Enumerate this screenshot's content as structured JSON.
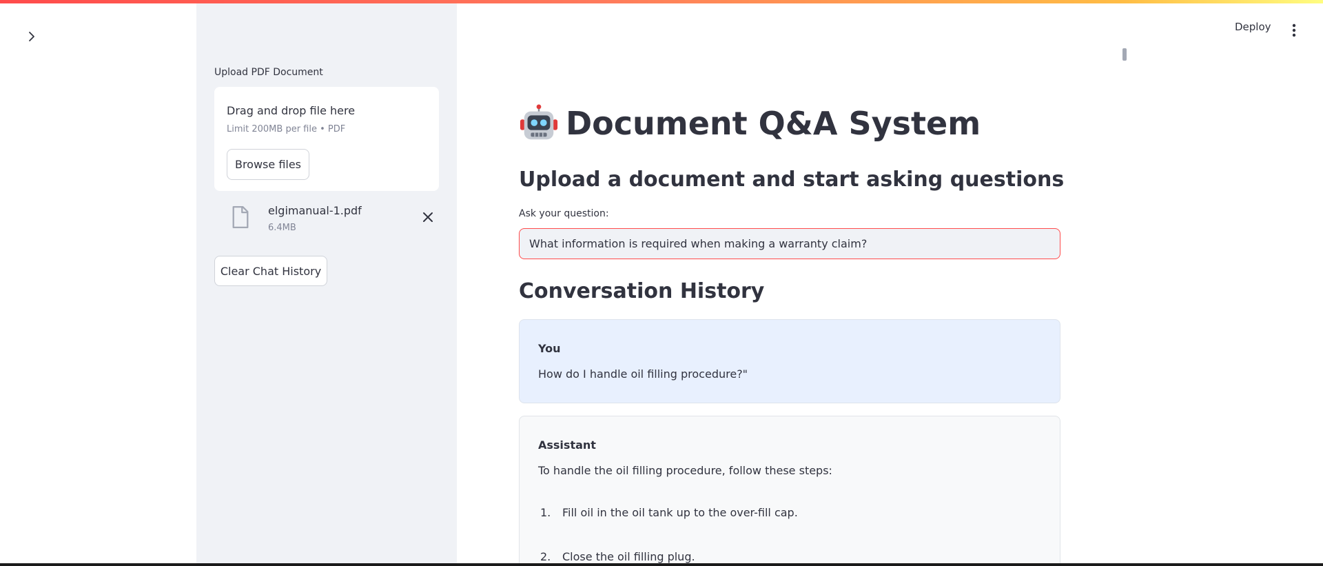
{
  "sidebar": {
    "uploader_label": "Upload PDF Document",
    "dropzone_title": "Drag and drop file here",
    "dropzone_limit": "Limit 200MB per file • PDF",
    "browse_label": "Browse files",
    "file": {
      "name": "elgimanual-1.pdf",
      "size": "6.4MB"
    },
    "clear_label": "Clear Chat History"
  },
  "toolbar": {
    "deploy_label": "Deploy",
    "menu_icon": "more-vertical-icon"
  },
  "main": {
    "title": "Document Q&A System",
    "title_icon": "robot-emoji",
    "subtitle": "Upload a document and start asking questions",
    "ask_label": "Ask your question:",
    "question_value": "What information is required when making a warranty claim?",
    "history_title": "Conversation History",
    "messages": [
      {
        "role": "You",
        "text": "How do I handle oil filling procedure?\""
      },
      {
        "role": "Assistant",
        "text": "To handle the oil filling procedure, follow these steps:",
        "steps": [
          {
            "num": "1.",
            "text": "Fill oil in the oil tank up to the over-fill cap."
          },
          {
            "num": "2.",
            "text": "Close the oil filling plug."
          }
        ]
      }
    ]
  },
  "colors": {
    "accent": "#ff4b4b",
    "sidebar_bg": "#f0f2f6",
    "user_msg_bg": "#e8f0fe",
    "assistant_msg_bg": "#f8f9fa"
  }
}
